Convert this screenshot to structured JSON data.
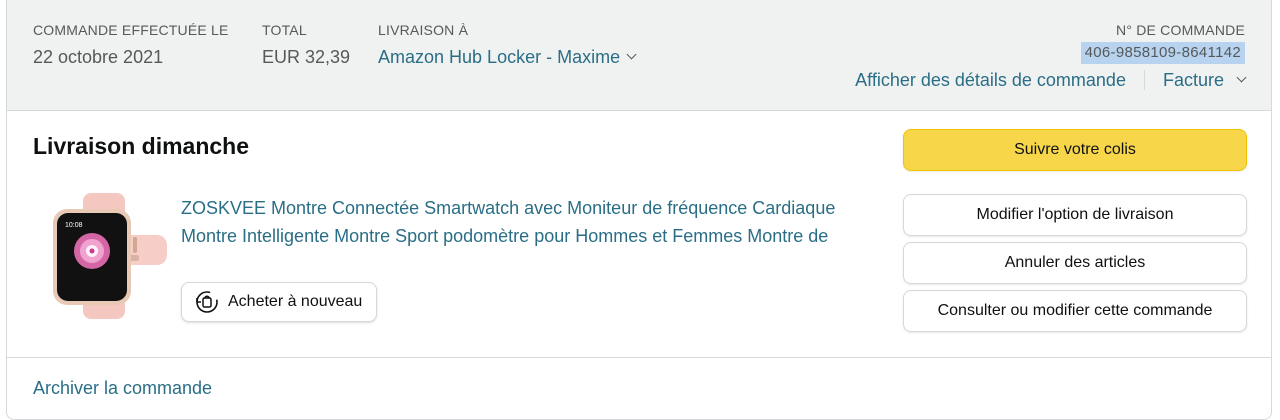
{
  "header": {
    "order_placed_label": "COMMANDE EFFECTUÉE LE",
    "order_placed_value": "22 octobre 2021",
    "total_label": "TOTAL",
    "total_value": "EUR 32,39",
    "ship_to_label": "LIVRAISON À",
    "ship_to_value": "Amazon Hub Locker - Maxime",
    "order_number_label": "N° DE COMMANDE",
    "order_number_value": "406-9858109-8641142",
    "details_link": "Afficher des détails de commande",
    "invoice_link": "Facture"
  },
  "shipment": {
    "status_title": "Livraison dimanche",
    "product_title": "ZOSKVEE Montre Connectée Smartwatch avec Moniteur de fréquence Cardiaque Montre Intelligente Montre Sport podomètre pour Hommes et Femmes Montre de",
    "buy_again_label": "Acheter à nouveau"
  },
  "actions": {
    "track": "Suivre votre colis",
    "change_delivery": "Modifier l'option de livraison",
    "cancel_items": "Annuler des articles",
    "view_edit_order": "Consulter ou modifier cette commande"
  },
  "footer": {
    "archive_link": "Archiver la commande"
  },
  "colors": {
    "link": "#2a6e86",
    "primary_button": "#f7d64a",
    "header_bg": "#f0f2f2",
    "highlight": "#b7d3ef"
  },
  "icons": {
    "ship_to_dropdown": "chevron-down-icon",
    "invoice_dropdown": "chevron-down-icon",
    "buy_again": "reorder-icon"
  }
}
